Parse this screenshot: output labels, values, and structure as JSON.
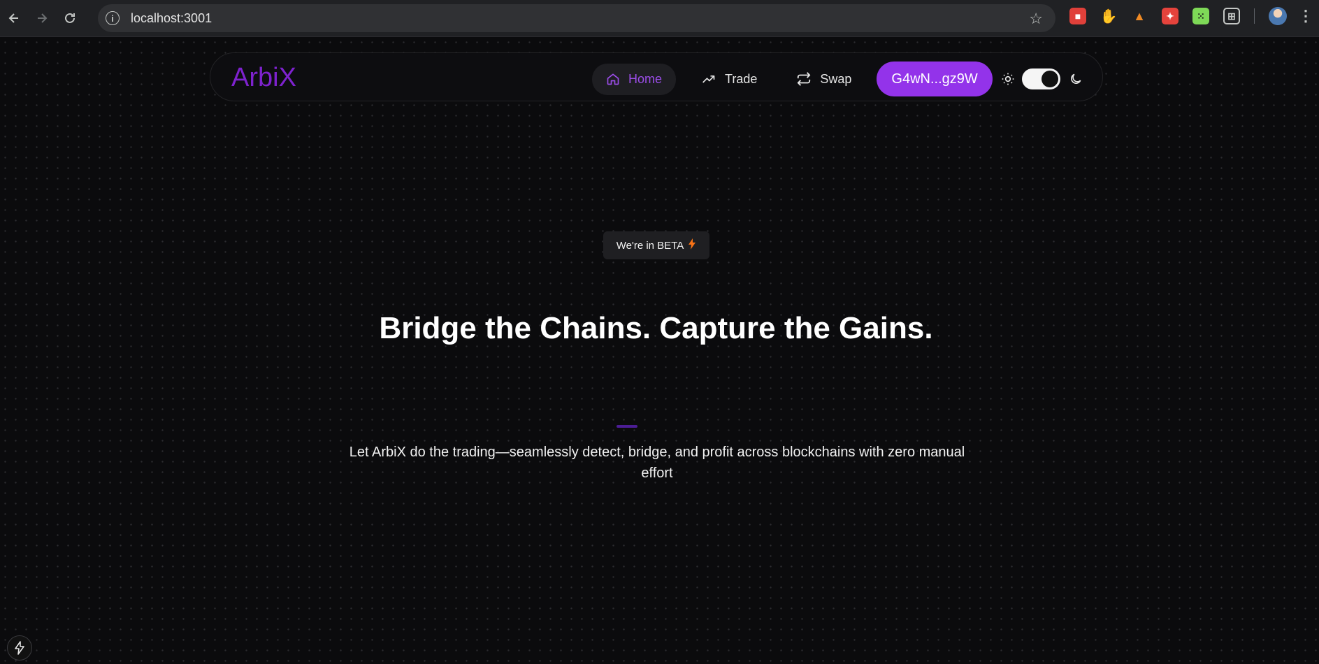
{
  "browser": {
    "url": "localhost:3001",
    "back_icon": "arrow-left-icon",
    "forward_icon": "arrow-right-icon",
    "reload_icon": "reload-icon",
    "star_icon": "bookmark-star-icon",
    "extensions": [
      "lock-icon",
      "hand-icon",
      "fox-icon",
      "game-icon",
      "dice-icon",
      "puzzle-icon"
    ]
  },
  "nav": {
    "logo": "ArbiX",
    "items": [
      {
        "label": "Home",
        "icon": "home-icon",
        "active": true
      },
      {
        "label": "Trade",
        "icon": "trending-up-icon",
        "active": false
      },
      {
        "label": "Swap",
        "icon": "repeat-icon",
        "active": false
      }
    ],
    "wallet_label": "G4wN...gz9W",
    "theme": "dark"
  },
  "hero": {
    "badge": "We're in BETA",
    "headline": "Bridge the Chains. Capture the Gains.",
    "subtext": "Let ArbiX do the trading—seamlessly detect, bridge, and profit across blockchains with zero manual effort"
  },
  "colors": {
    "accent": "#9333ea",
    "logo": "#7e22ce",
    "background": "#0b0b0d",
    "bolt": "#f97316"
  }
}
